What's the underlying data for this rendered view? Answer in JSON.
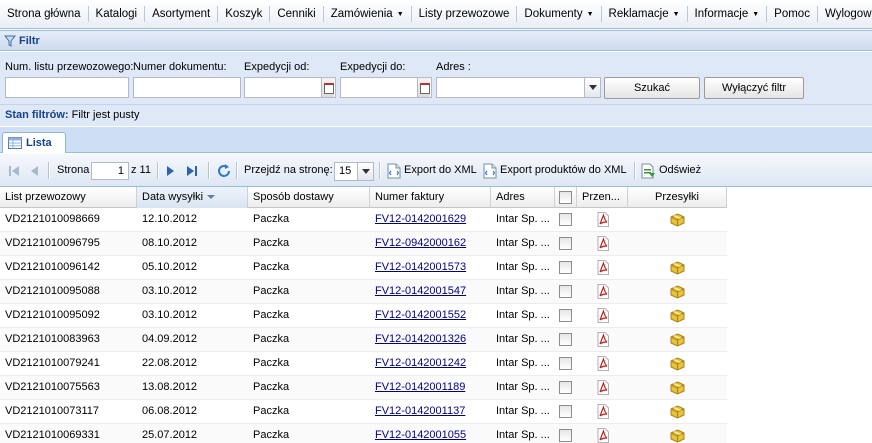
{
  "menu": [
    {
      "label": "Strona główna",
      "dropdown": false
    },
    {
      "label": "Katalogi",
      "dropdown": false
    },
    {
      "label": "Asortyment",
      "dropdown": false
    },
    {
      "label": "Koszyk",
      "dropdown": false
    },
    {
      "label": "Cenniki",
      "dropdown": false
    },
    {
      "label": "Zamówienia",
      "dropdown": true
    },
    {
      "label": "Listy przewozowe",
      "dropdown": false
    },
    {
      "label": "Dokumenty",
      "dropdown": true
    },
    {
      "label": "Reklamacje",
      "dropdown": true
    },
    {
      "label": "Informacje",
      "dropdown": true
    },
    {
      "label": "Pomoc",
      "dropdown": false
    },
    {
      "label": "Wylogować",
      "dropdown": false
    }
  ],
  "filter": {
    "title": "Filtr",
    "labels": {
      "waybill_no": "Num. listu przewozowego:",
      "document_no": "Numer dokumentu:",
      "shipped_from": "Expedycji od:",
      "shipped_to": "Expedycji do:",
      "address": "Adres :"
    },
    "values": {
      "waybill_no": "",
      "document_no": "",
      "shipped_from": "",
      "shipped_to": "",
      "address": ""
    },
    "search_button": "Szukać",
    "clear_button": "Wyłączyć filtr",
    "status_label": "Stan filtrów:",
    "status_value": "Filtr jest pusty"
  },
  "tabs": [
    {
      "label": "Lista",
      "active": true
    }
  ],
  "toolbar": {
    "page_label": "Strona",
    "page_value": "1",
    "page_of": "z 11",
    "goto_label": "Przejdź na stronę:",
    "goto_value": "15",
    "export_xml": "Export do XML",
    "export_products_xml": "Export produktów do XML",
    "refresh": "Odśwież"
  },
  "grid": {
    "columns": {
      "waybill": "List przewozowy",
      "ship_date": "Data wysyłki",
      "delivery": "Sposób dostawy",
      "invoice": "Numer faktury",
      "address": "Adres",
      "check": "",
      "transfer": "Przen...",
      "parcels": "Przesyłki"
    },
    "sorted_column": "ship_date",
    "rows": [
      {
        "waybill": "VD2121010098669",
        "ship_date": "12.10.2012",
        "delivery": "Paczka",
        "invoice": "FV12-0142001629",
        "address": "Intar Sp. ...",
        "has_parcel": true
      },
      {
        "waybill": "VD2121010096795",
        "ship_date": "08.10.2012",
        "delivery": "Paczka",
        "invoice": "FV12-0942000162",
        "address": "Intar Sp. ...",
        "has_parcel": false
      },
      {
        "waybill": "VD2121010096142",
        "ship_date": "05.10.2012",
        "delivery": "Paczka",
        "invoice": "FV12-0142001573",
        "address": "Intar Sp. ...",
        "has_parcel": true
      },
      {
        "waybill": "VD2121010095088",
        "ship_date": "03.10.2012",
        "delivery": "Paczka",
        "invoice": "FV12-0142001547",
        "address": "Intar Sp. ...",
        "has_parcel": true
      },
      {
        "waybill": "VD2121010095092",
        "ship_date": "03.10.2012",
        "delivery": "Paczka",
        "invoice": "FV12-0142001552",
        "address": "Intar Sp. ...",
        "has_parcel": true
      },
      {
        "waybill": "VD2121010083963",
        "ship_date": "04.09.2012",
        "delivery": "Paczka",
        "invoice": "FV12-0142001326",
        "address": "Intar Sp. ...",
        "has_parcel": true
      },
      {
        "waybill": "VD2121010079241",
        "ship_date": "22.08.2012",
        "delivery": "Paczka",
        "invoice": "FV12-0142001242",
        "address": "Intar Sp. ...",
        "has_parcel": true
      },
      {
        "waybill": "VD2121010075563",
        "ship_date": "13.08.2012",
        "delivery": "Paczka",
        "invoice": "FV12-0142001189",
        "address": "Intar Sp. ...",
        "has_parcel": true
      },
      {
        "waybill": "VD2121010073117",
        "ship_date": "06.08.2012",
        "delivery": "Paczka",
        "invoice": "FV12-0142001137",
        "address": "Intar Sp. ...",
        "has_parcel": true
      },
      {
        "waybill": "VD2121010069331",
        "ship_date": "25.07.2012",
        "delivery": "Paczka",
        "invoice": "FV12-0142001055",
        "address": "Intar Sp. ...",
        "has_parcel": true
      }
    ]
  },
  "colors": {
    "accent": "#15428b",
    "panel_bg": "#dfe8f6",
    "link": "#00008b",
    "pdf_red": "#cc2222",
    "parcel_yellow": "#e8c23a"
  }
}
